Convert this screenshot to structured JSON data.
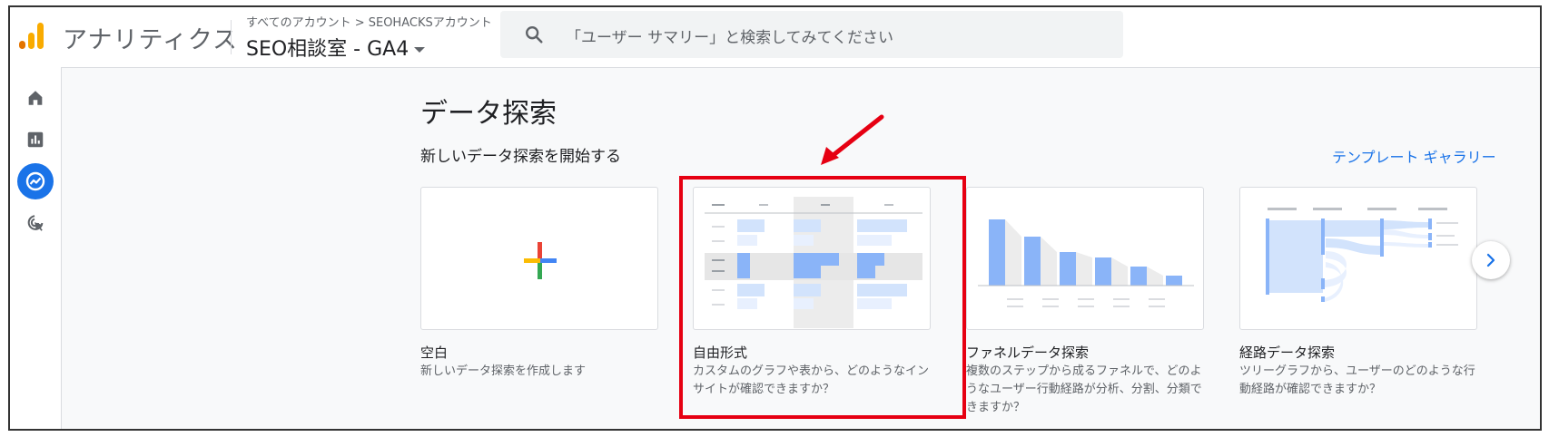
{
  "header": {
    "app_title": "アナリティクス",
    "breadcrumb": "すべてのアカウント > SEOHACKSアカウント",
    "property_name": "SEO相談室 - GA4",
    "search_placeholder": "「ユーザー サマリー」と検索してみてください"
  },
  "rail": {
    "items": [
      {
        "icon": "home-icon",
        "active": false
      },
      {
        "icon": "reports-icon",
        "active": false
      },
      {
        "icon": "explore-icon",
        "active": true
      },
      {
        "icon": "advertising-icon",
        "active": false
      }
    ]
  },
  "main": {
    "title": "データ探索",
    "subtitle": "新しいデータ探索を開始する",
    "gallery_link": "テンプレート ギャラリー",
    "cards": [
      {
        "title": "空白",
        "desc": "新しいデータ探索を作成します"
      },
      {
        "title": "自由形式",
        "desc": "カスタムのグラフや表から、どのようなインサイトが確認できますか？"
      },
      {
        "title": "ファネルデータ探索",
        "desc": "複数のステップから成るファネルで、どのようなユーザー行動経路が分析、分割、分類できますか？"
      },
      {
        "title": "経路データ探索",
        "desc": "ツリーグラフから、ユーザーのどのような行動経路が確認できますか？"
      }
    ]
  },
  "colors": {
    "accent": "#1a73e8",
    "highlight": "#e60012",
    "logo_orange": "#f9ab00",
    "logo_dark_orange": "#e37400",
    "chart_blue": "#8ab4f8",
    "chart_light_blue": "#d2e3fc"
  }
}
